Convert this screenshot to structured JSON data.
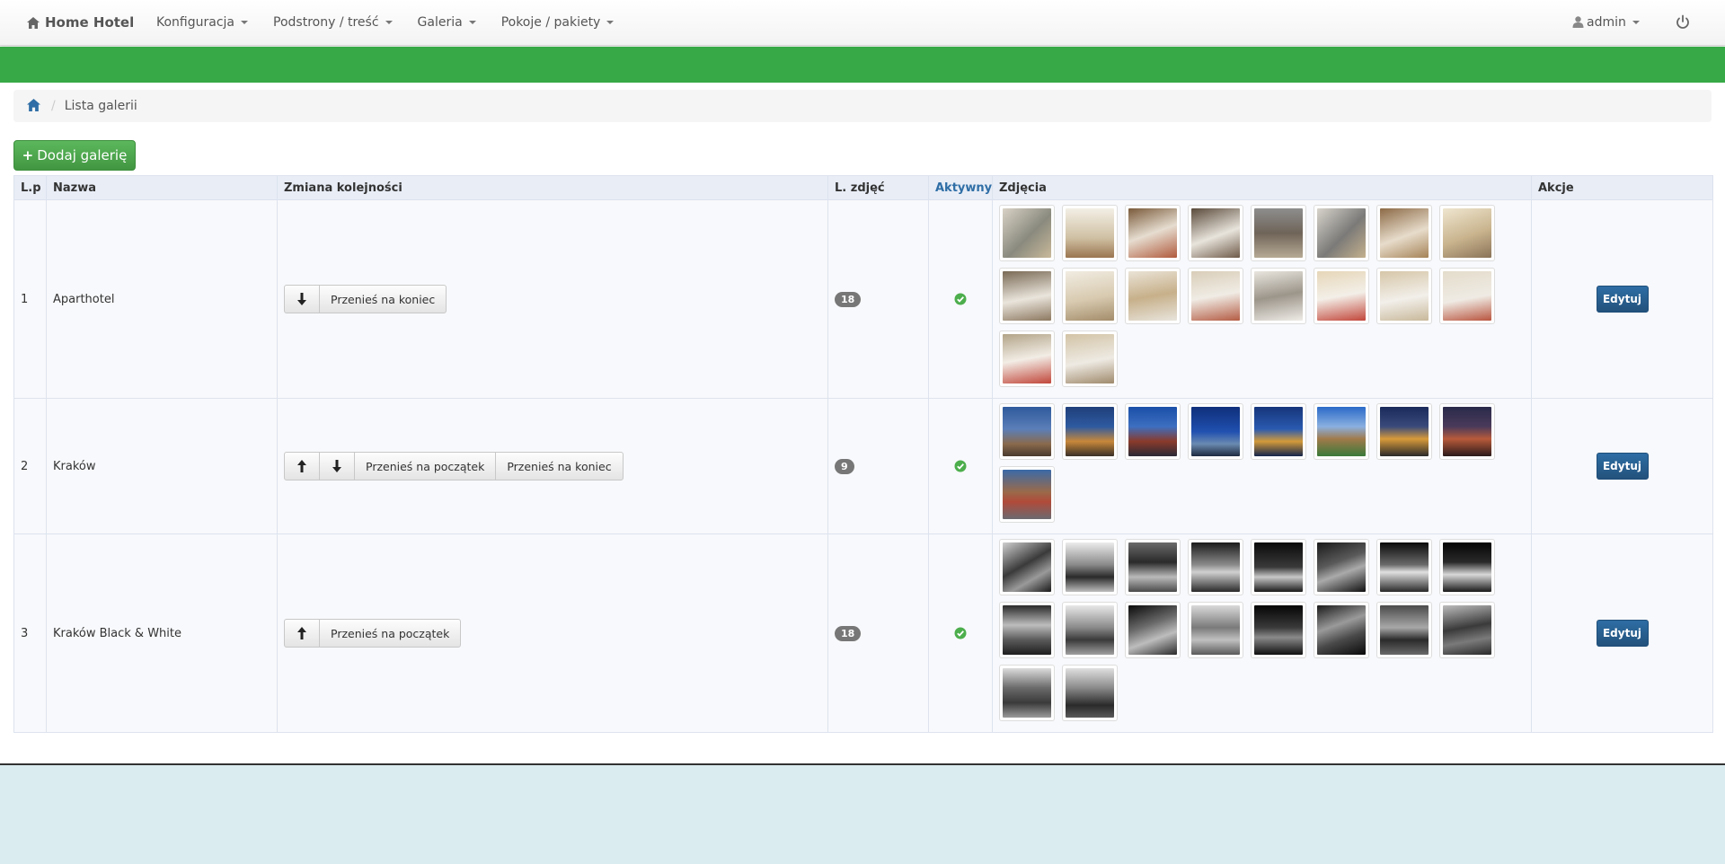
{
  "brand": {
    "label": "Home Hotel",
    "icon": "home-icon"
  },
  "nav": {
    "items": [
      {
        "label": "Konfiguracja"
      },
      {
        "label": "Podstrony / treść"
      },
      {
        "label": "Galeria"
      },
      {
        "label": "Pokoje / pakiety"
      }
    ],
    "user": "admin"
  },
  "breadcrumb": {
    "current": "Lista galerii",
    "separator": "/"
  },
  "add_button": {
    "plus": "+",
    "label": "Dodaj galerię"
  },
  "table": {
    "headers": {
      "lp": "L.p",
      "name": "Nazwa",
      "order": "Zmiana kolejności",
      "count": "L. zdjęć",
      "active": "Aktywny",
      "photos": "Zdjęcia",
      "actions": "Akcje"
    },
    "rows": [
      {
        "lp": "1",
        "name": "Aparthotel",
        "buttons": {
          "down": true,
          "top_label": "",
          "end_label": "Przenieś na koniec"
        },
        "count": "18",
        "active": true,
        "edit": "Edytuj"
      },
      {
        "lp": "2",
        "name": "Kraków",
        "buttons": {
          "up": true,
          "down": true,
          "top_label": "Przenieś na początek",
          "end_label": "Przenieś na koniec"
        },
        "count": "9",
        "active": true,
        "edit": "Edytuj"
      },
      {
        "lp": "3",
        "name": "Kraków Black & White",
        "buttons": {
          "up": true,
          "top_label": "Przenieś na początek",
          "end_label": ""
        },
        "count": "18",
        "active": true,
        "edit": "Edytuj"
      }
    ]
  },
  "colors": {
    "green_bar": "#37a946",
    "primary": "#2e6da4",
    "success": "#5cb85c",
    "footer": "#dbecf0"
  }
}
